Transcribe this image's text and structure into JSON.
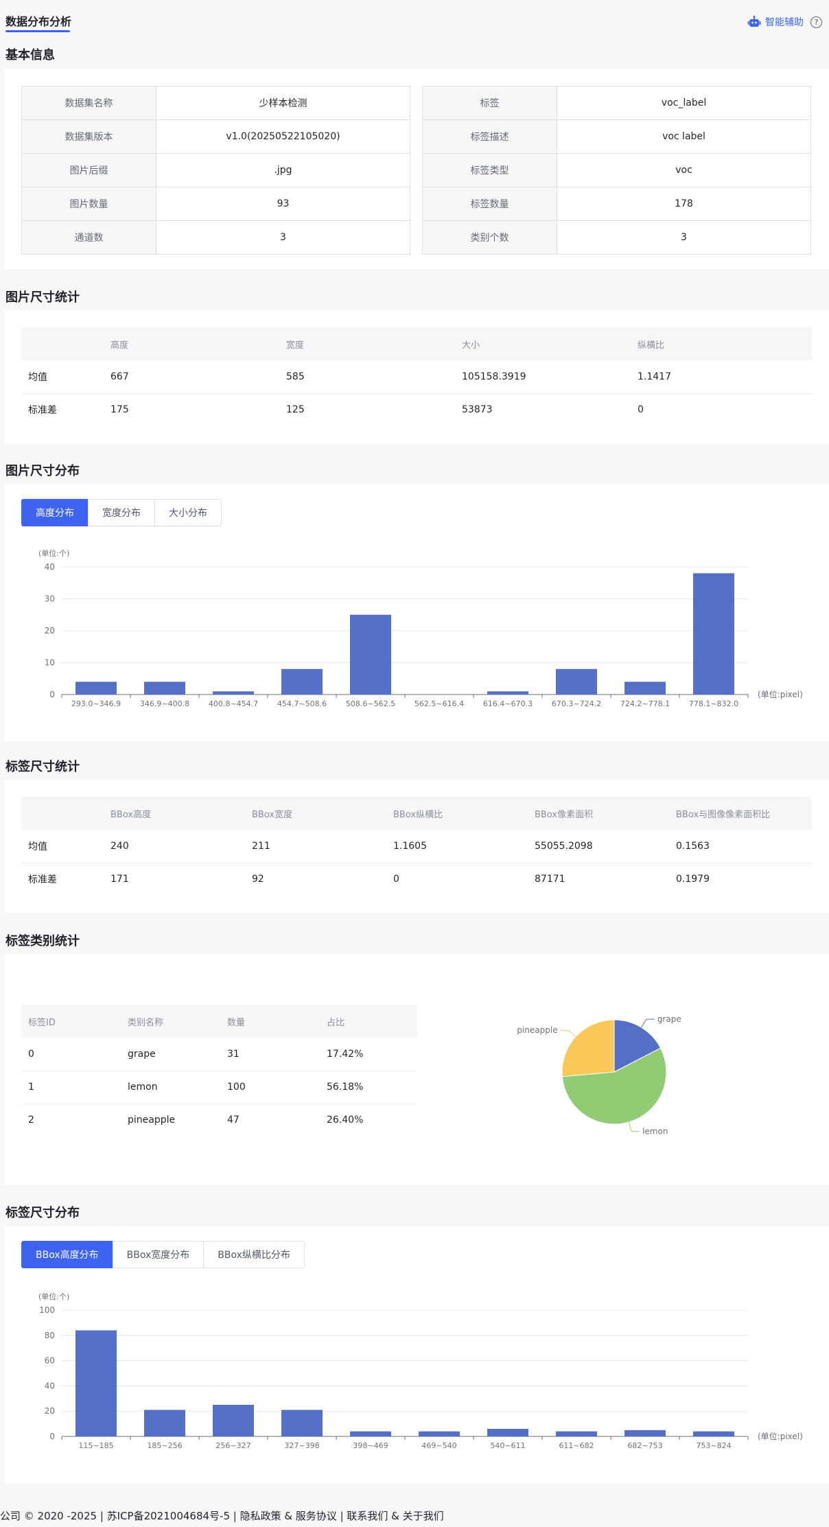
{
  "header": {
    "page_tab": "数据分布分析",
    "assist_label": "智能辅助",
    "help_glyph": "?"
  },
  "sections": {
    "basic": "基本信息",
    "img_stats": "图片尺寸统计",
    "img_dist": "图片尺寸分布",
    "label_stats": "标签尺寸统计",
    "category_stats": "标签类别统计",
    "label_dist": "标签尺寸分布"
  },
  "basic_info": {
    "left": [
      {
        "key": "数据集名称",
        "value": "少样本检测"
      },
      {
        "key": "数据集版本",
        "value": "v1.0(20250522105020)"
      },
      {
        "key": "图片后缀",
        "value": ".jpg"
      },
      {
        "key": "图片数量",
        "value": "93"
      },
      {
        "key": "通道数",
        "value": "3"
      }
    ],
    "right": [
      {
        "key": "标签",
        "value": "voc_label"
      },
      {
        "key": "标签描述",
        "value": "voc label"
      },
      {
        "key": "标签类型",
        "value": "voc"
      },
      {
        "key": "标签数量",
        "value": "178"
      },
      {
        "key": "类别个数",
        "value": "3"
      }
    ]
  },
  "img_stats": {
    "headers": [
      "",
      "高度",
      "宽度",
      "大小",
      "纵横比"
    ],
    "rows": [
      [
        "均值",
        "667",
        "585",
        "105158.3919",
        "1.1417"
      ],
      [
        "标准差",
        "175",
        "125",
        "53873",
        "0"
      ]
    ]
  },
  "img_dist": {
    "tabs": [
      "高度分布",
      "宽度分布",
      "大小分布"
    ],
    "active_tab": 0
  },
  "label_stats": {
    "headers": [
      "",
      "BBox高度",
      "BBox宽度",
      "BBox纵横比",
      "BBox像素面积",
      "BBox与图像像素面积比"
    ],
    "rows": [
      [
        "均值",
        "240",
        "211",
        "1.1605",
        "55055.2098",
        "0.1563"
      ],
      [
        "标准差",
        "171",
        "92",
        "0",
        "87171",
        "0.1979"
      ]
    ]
  },
  "category_stats": {
    "headers": [
      "标签ID",
      "类别名称",
      "数量",
      "占比"
    ],
    "rows": [
      [
        "0",
        "grape",
        "31",
        "17.42%"
      ],
      [
        "1",
        "lemon",
        "100",
        "56.18%"
      ],
      [
        "2",
        "pineapple",
        "47",
        "26.40%"
      ]
    ]
  },
  "label_dist": {
    "tabs": [
      "BBox高度分布",
      "BBox宽度分布",
      "BBox纵横比分布"
    ],
    "active_tab": 0
  },
  "chart_data": [
    {
      "type": "bar",
      "y_unit": "(单位:个)",
      "x_unit": "(单位:pixel)",
      "categories": [
        "293.0~346.9",
        "346.9~400.8",
        "400.8~454.7",
        "454.7~508.6",
        "508.6~562.5",
        "562.5~616.4",
        "616.4~670.3",
        "670.3~724.2",
        "724.2~778.1",
        "778.1~832.0"
      ],
      "values": [
        4,
        4,
        1,
        8,
        25,
        0,
        1,
        8,
        4,
        38
      ],
      "ylim": [
        0,
        40
      ],
      "yticks": [
        0,
        10,
        20,
        30,
        40
      ],
      "color": "#5470c6"
    },
    {
      "type": "pie",
      "labels": [
        "grape",
        "lemon",
        "pineapple"
      ],
      "values": [
        31,
        100,
        47
      ],
      "colors": [
        "#5470c6",
        "#91cc75",
        "#fac858"
      ]
    },
    {
      "type": "bar",
      "y_unit": "(单位:个)",
      "x_unit": "(单位:pixel)",
      "categories": [
        "115~185",
        "185~256",
        "256~327",
        "327~398",
        "398~469",
        "469~540",
        "540~611",
        "611~682",
        "682~753",
        "753~824"
      ],
      "values": [
        84,
        21,
        25,
        21,
        4,
        4,
        6,
        4,
        5,
        4
      ],
      "ylim": [
        0,
        100
      ],
      "yticks": [
        0,
        20,
        40,
        60,
        80,
        100
      ],
      "color": "#5470c6"
    }
  ],
  "footer": {
    "text": "公司 © 2020 -2025 | 苏ICP备2021004684号-5 | 隐私政策 & 服务协议 | 联系我们  &  关于我们"
  }
}
